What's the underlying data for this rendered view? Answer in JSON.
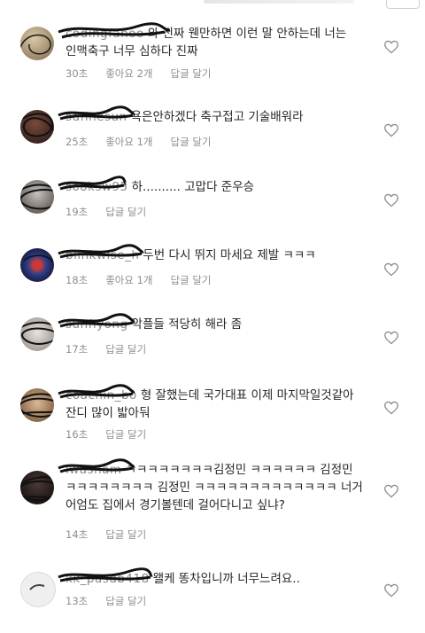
{
  "comments": [
    {
      "username": "codingfanoo",
      "text": "와 진짜 웬만하면 이런 말 안하는데 너는 인맥축구 너무 심하다 진짜",
      "time": "30초",
      "likes": "좋아요 2개",
      "reply": "답글 달기"
    },
    {
      "username": "sdfinesun",
      "text": "욕은안하겠다 축구접고 기술배워라",
      "time": "25초",
      "likes": "좋아요 1개",
      "reply": "답글 달기"
    },
    {
      "username": "sooksw95",
      "text": "하.......... 고맙다 준우승",
      "time": "19초",
      "likes": "",
      "reply": "답글 달기"
    },
    {
      "username": "blinkwise_h",
      "text": "두번 다시 뛰지 마세요 제발 ㅋㅋㅋ",
      "time": "18초",
      "likes": "좋아요 1개",
      "reply": "답글 달기"
    },
    {
      "username": "sunflyong",
      "text": "악플들 적당히 해라 좀",
      "time": "17초",
      "likes": "",
      "reply": "답글 달기"
    },
    {
      "username": "coachin_bo",
      "text": "형 잘했는데  국가대표 이제 마지막일것같아 잔디 많이 밟아둬",
      "time": "16초",
      "likes": "",
      "reply": "답글 달기"
    },
    {
      "username": "lwasnam",
      "text": "ㅋㅋㅋㅋㅋㅋㅋㅋ김정민 ㅋㅋㅋㅋㅋㅋ 김정민 ㅋㅋㅋㅋㅋㅋㅋㅋ 김정민 ㅋㅋㅋㅋㅋㅋㅋㅋㅋㅋㅋㅋㅋ 너거 어엄도 집에서 경기볼텐데 걸어다니고 싶냐?",
      "time": "14초",
      "likes": "",
      "reply": "답글 달기"
    },
    {
      "username": "kk_pasdb418",
      "text": "왤케 똥차입니까 너무느려요..",
      "time": "13초",
      "likes": "",
      "reply": "답글 달기"
    }
  ]
}
